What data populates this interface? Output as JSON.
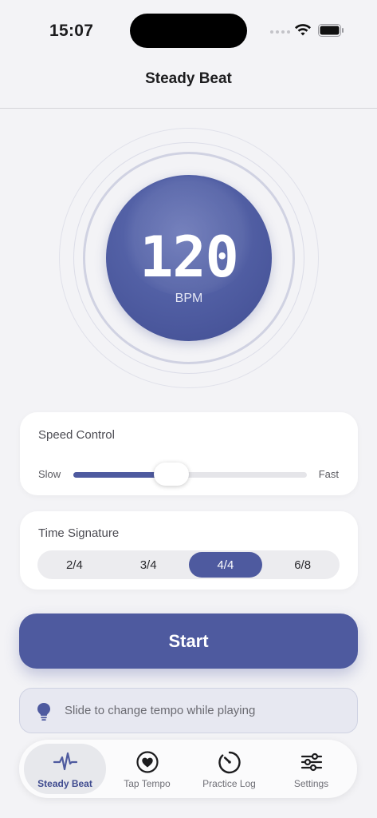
{
  "status_bar": {
    "time": "15:07"
  },
  "nav": {
    "title": "Steady Beat"
  },
  "tempo": {
    "value": "120",
    "unit": "BPM"
  },
  "speed_control": {
    "title": "Speed Control",
    "min_label": "Slow",
    "max_label": "Fast",
    "value_fraction": 0.42
  },
  "time_signature": {
    "title": "Time Signature",
    "options": [
      "2/4",
      "3/4",
      "4/4",
      "6/8"
    ],
    "selected": "4/4"
  },
  "start_button": {
    "label": "Start"
  },
  "hint": {
    "text": "Slide to change tempo while playing"
  },
  "tab_bar": {
    "tabs": [
      {
        "label": "Steady Beat",
        "icon": "pulse-icon",
        "active": true
      },
      {
        "label": "Tap Tempo",
        "icon": "heart-icon",
        "active": false
      },
      {
        "label": "Practice Log",
        "icon": "timer-icon",
        "active": false
      },
      {
        "label": "Settings",
        "icon": "sliders-icon",
        "active": false
      }
    ]
  },
  "colors": {
    "accent": "#4e5a9f",
    "background": "#f3f3f6"
  }
}
